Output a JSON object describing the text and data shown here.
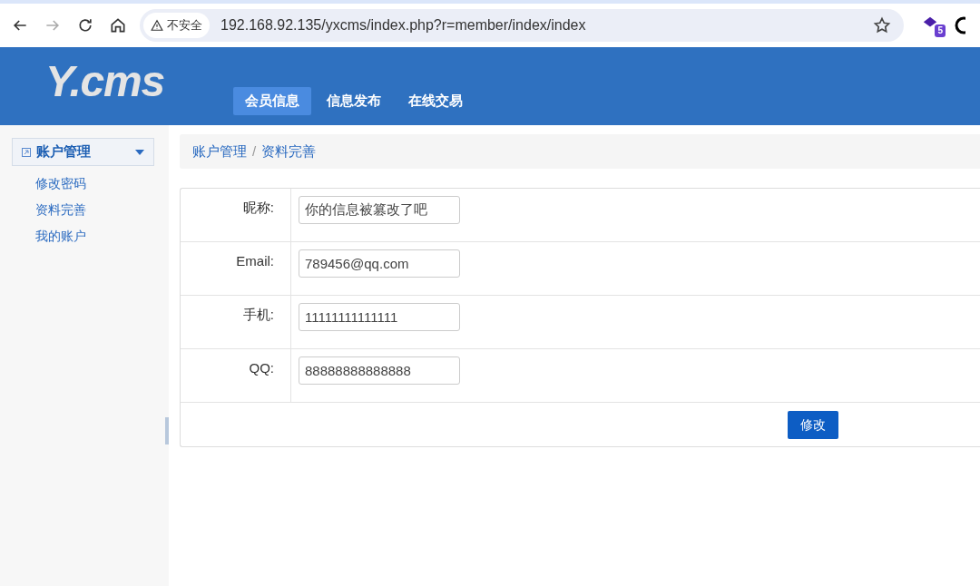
{
  "browser": {
    "security_label": "不安全",
    "url": "192.168.92.135/yxcms/index.php?r=member/index/index",
    "extension_badge": "5"
  },
  "header": {
    "logo": "Y.cms",
    "nav": [
      {
        "label": "会员信息",
        "selected": true
      },
      {
        "label": "信息发布",
        "selected": false
      },
      {
        "label": "在线交易",
        "selected": false
      }
    ]
  },
  "sidebar": {
    "section": {
      "title": "账户管理",
      "expanded": true,
      "items": [
        "修改密码",
        "资料完善",
        "我的账户"
      ]
    }
  },
  "breadcrumb": [
    "账户管理",
    "资料完善"
  ],
  "breadcrumb_separator": "/",
  "form": {
    "fields": [
      {
        "label": "昵称:",
        "value": "你的信息被篡改了吧"
      },
      {
        "label": "Email:",
        "value": "789456@qq.com"
      },
      {
        "label": "手机:",
        "value": "11111111111111"
      },
      {
        "label": "QQ:",
        "value": "88888888888888"
      }
    ],
    "submit": "修改"
  }
}
